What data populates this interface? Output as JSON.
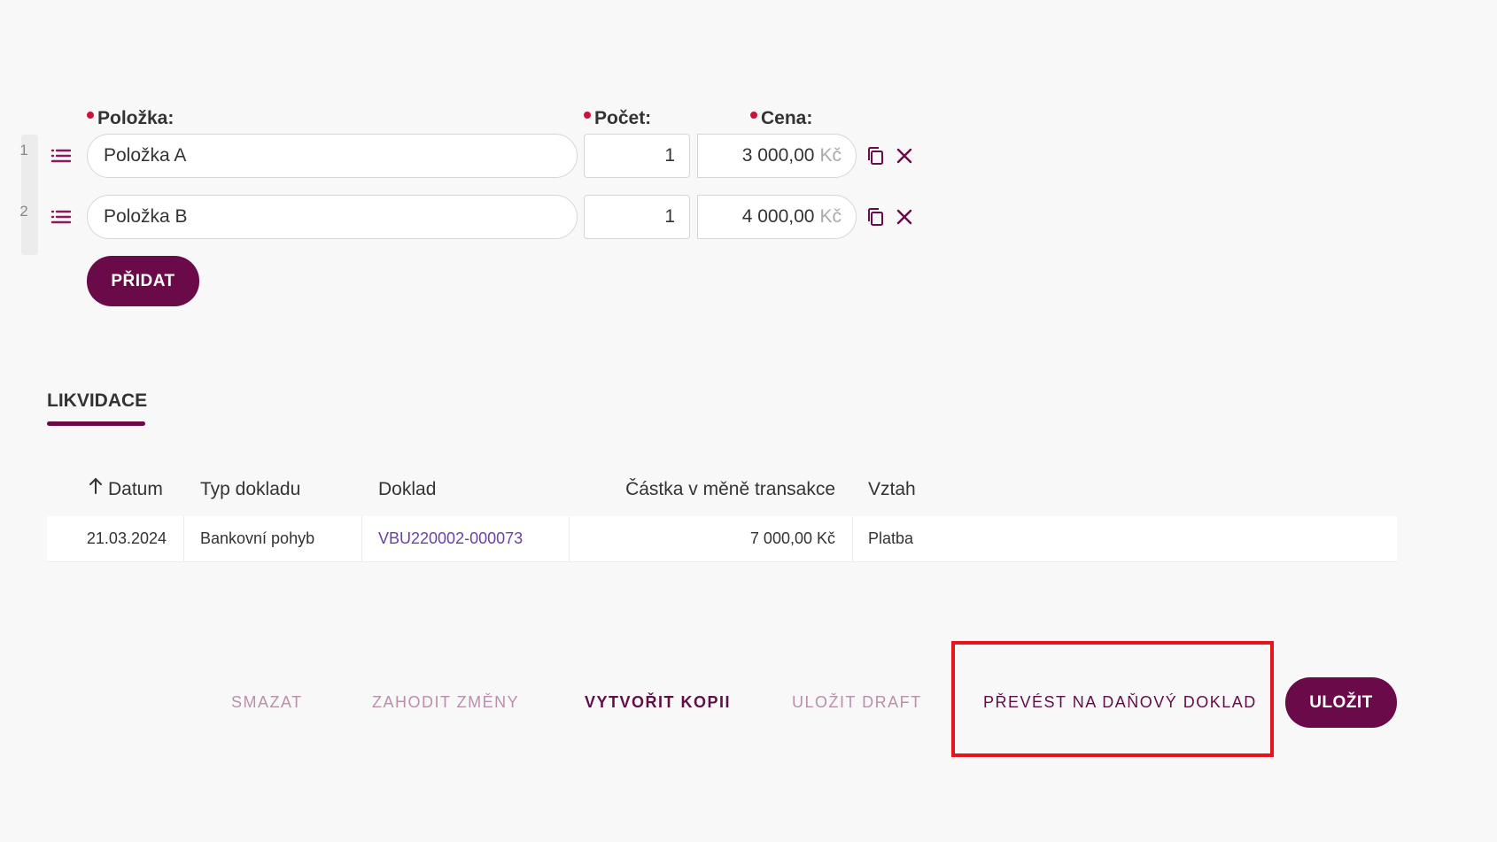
{
  "items_form": {
    "columns": {
      "item": "Položka:",
      "count": "Počet:",
      "price": "Cena:"
    },
    "rows": [
      {
        "num": "1",
        "item": "Položka A",
        "count": "1",
        "price": "3 000,00",
        "currency": "Kč"
      },
      {
        "num": "2",
        "item": "Položka B",
        "count": "1",
        "price": "4 000,00",
        "currency": "Kč"
      }
    ],
    "add_button": "PŘIDAT"
  },
  "likvidace": {
    "title": "LIKVIDACE",
    "headers": {
      "date": "Datum",
      "type": "Typ dokladu",
      "doc": "Doklad",
      "amount": "Částka v měně transakce",
      "relation": "Vztah"
    },
    "rows": [
      {
        "date": "21.03.2024",
        "type": "Bankovní pohyb",
        "doc": "VBU220002-000073",
        "amount": "7 000,00 Kč",
        "relation": "Platba"
      }
    ]
  },
  "footer": {
    "delete": "SMAZAT",
    "discard": "ZAHODIT ZMĚNY",
    "copy": "VYTVOŘIT KOPII",
    "save_draft": "ULOŽIT DRAFT",
    "convert": "PŘEVÉST NA DAŇOVÝ DOKLAD",
    "save": "ULOŽIT"
  },
  "colors": {
    "accent": "#6a0a48",
    "required": "#d0103a",
    "highlight": "#e8141a",
    "link": "#6b3fa8"
  }
}
